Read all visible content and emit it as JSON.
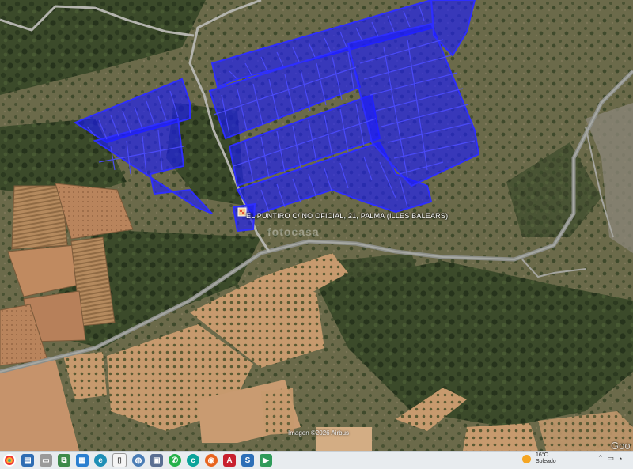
{
  "map": {
    "marker_label": "EL PUNTIRO C/ NO OFICIAL, 21, PALMA (ILLES BALEARS)",
    "watermark": "fotocasa",
    "imagery_credit": "Imagen ©2026 Airbus",
    "brand_partial": "Goo",
    "parcel_color": "#1a1aff",
    "parcel_outline": "#2a2aff"
  },
  "taskbar": {
    "icons": [
      "start-icon",
      "explorer-icon",
      "desktop-icon",
      "task-view-icon",
      "photos-icon",
      "edge-icon",
      "document-icon",
      "maps-icon",
      "save-icon",
      "whatsapp-icon",
      "browser-icon",
      "firefox-icon",
      "acrobat-icon",
      "app-s-icon",
      "app-green-icon"
    ],
    "weather_temp": "16°C",
    "weather_desc": "Soleado"
  }
}
